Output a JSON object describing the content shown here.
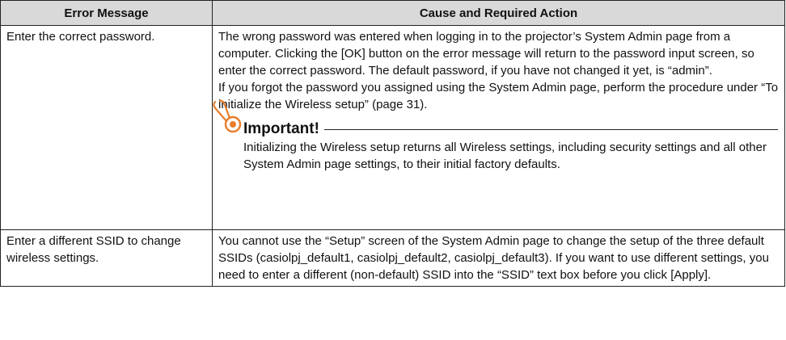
{
  "table": {
    "headers": [
      "Error Message",
      "Cause and Required Action"
    ],
    "rows": [
      {
        "message": "Enter the correct password.",
        "paragraphs": [
          "The wrong password was entered when logging in to the projector’s System Admin page from a computer. Clicking the [OK] button on the error message will return to the password input screen, so enter the correct password. The default password, if you have not changed it yet, is “admin”.",
          "If you forgot the password you assigned using the System Admin page, perform the procedure under “To initialize the Wireless setup” (page 31)."
        ],
        "important": {
          "title": "Important!",
          "text": "Initializing the Wireless setup returns all Wireless settings, including security settings and all other System Admin page settings, to their initial factory defaults.",
          "icon": "pin-icon"
        }
      },
      {
        "message": "Enter a different SSID to change wireless settings.",
        "paragraphs": [
          "You cannot use the “Setup” screen of the System Admin page to change the setup of the three default SSIDs (casiolpj_default1, casiolpj_default2, casiolpj_default3). If you want to use different settings, you need to enter a different (non-default) SSID into the “SSID” text box before you click [Apply]."
        ]
      }
    ]
  },
  "colors": {
    "header_bg": "#d9d9d9",
    "border": "#222222",
    "icon_accent": "#e87d2b"
  }
}
